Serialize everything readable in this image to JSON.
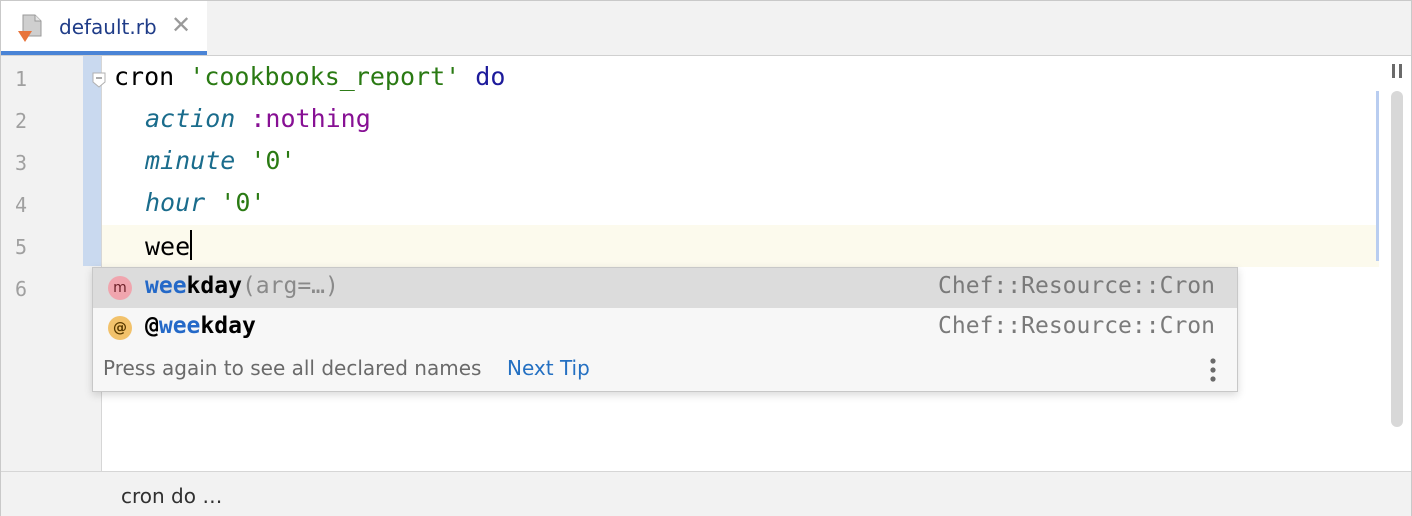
{
  "tab": {
    "filename": "default.rb",
    "close_glyph": "✕",
    "icon": "ruby-chef-file-icon"
  },
  "gutter": {
    "line_numbers": [
      "1",
      "2",
      "3",
      "4",
      "5",
      "6"
    ]
  },
  "code": {
    "line1": {
      "t1": "cron ",
      "t2": "'cookbooks_report'",
      "t3": " ",
      "t4": "do"
    },
    "line2": {
      "t1": "action",
      "t2": " ",
      "t3": ":nothing"
    },
    "line3": {
      "t1": "minute",
      "t2": " ",
      "t3": "'0'"
    },
    "line4": {
      "t1": "hour",
      "t2": " ",
      "t3": "'0'"
    },
    "line5": {
      "t1": "wee"
    }
  },
  "completion": {
    "items": [
      {
        "badge": "m",
        "match": "wee",
        "rest": "kday",
        "args": "(arg=…)",
        "type": "Chef::Resource::Cron"
      },
      {
        "badge": "@",
        "prefix": "@",
        "match": "wee",
        "rest": "kday",
        "type": "Chef::Resource::Cron"
      }
    ],
    "tip": "Press again to see all declared names",
    "tip_link": "Next Tip"
  },
  "breadcrumb": "cron do …",
  "colors": {
    "keyword": "#1d1b9b",
    "string": "#2a7a13",
    "symbol": "#871094",
    "method": "#1a6c8c",
    "match_highlight": "#2469c8",
    "link": "#2470c2"
  }
}
